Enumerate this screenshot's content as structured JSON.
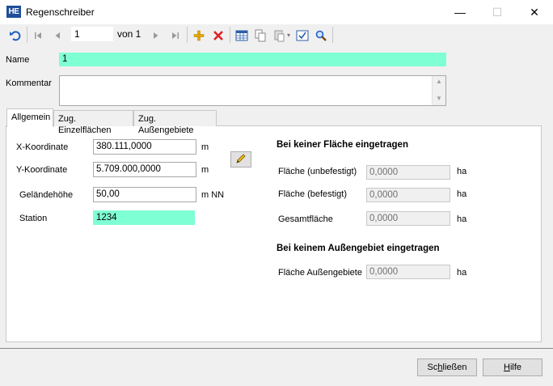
{
  "window": {
    "app_icon": "HE",
    "title": "Regenschreiber",
    "minimize_icon": "—",
    "maximize_icon": "☐",
    "close_icon": "✕"
  },
  "toolbar": {
    "record_value": "1",
    "of_text": "von 1"
  },
  "form": {
    "name_label": "Name",
    "name_value": "1",
    "comment_label": "Kommentar",
    "comment_value": ""
  },
  "tabs": [
    {
      "label": "Allgemein",
      "active": true
    },
    {
      "label": "Zug. Einzelflächen",
      "active": false
    },
    {
      "label": "Zug. Außengebiete",
      "active": false
    }
  ],
  "general": {
    "x_label": "X-Koordinate",
    "x_value": "380.111,0000",
    "x_unit": "m",
    "y_label": "Y-Koordinate",
    "y_value": "5.709.000,0000",
    "y_unit": "m",
    "ground_label": "Geländehöhe",
    "ground_value": "50,00",
    "ground_unit": "m NN",
    "station_label": "Station",
    "station_value": "1234"
  },
  "area_no_surface": {
    "title": "Bei keiner Fläche eingetragen",
    "unpaved_label": "Fläche (unbefestigt)",
    "unpaved_value": "0,0000",
    "unpaved_unit": "ha",
    "paved_label": "Fläche (befestigt)",
    "paved_value": "0,0000",
    "paved_unit": "ha",
    "total_label": "Gesamtfläche",
    "total_value": "0,0000",
    "total_unit": "ha"
  },
  "area_no_external": {
    "title": "Bei keinem Außengebiet eingetragen",
    "external_label": "Fläche Außengebiete",
    "external_value": "0,0000",
    "external_unit": "ha"
  },
  "buttons": {
    "close_label_pre": "Sc",
    "close_label_u": "h",
    "close_label_post": "ließen",
    "help_label_u": "H",
    "help_label_post": "ilfe"
  },
  "colors": {
    "highlight_field": "#7fffd4",
    "app_icon_bg": "#1f4e9a"
  }
}
